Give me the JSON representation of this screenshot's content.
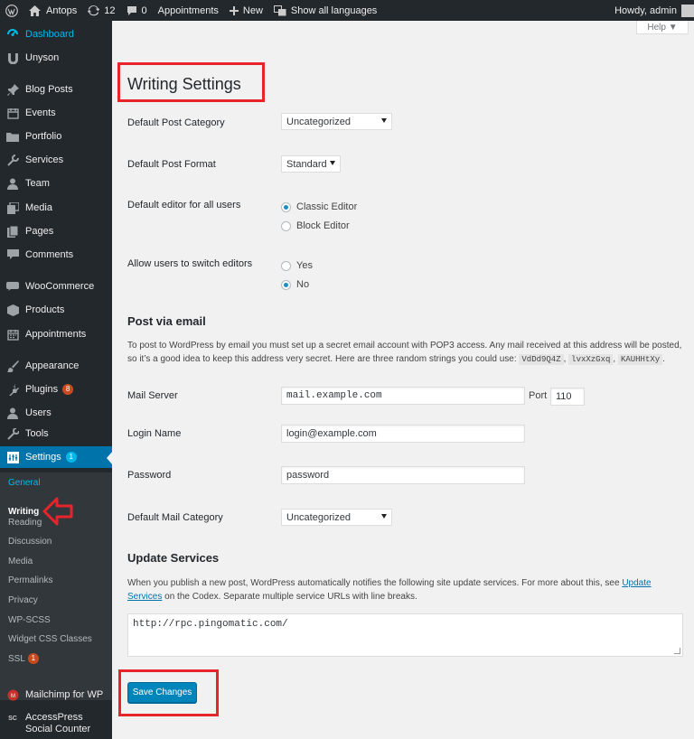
{
  "adminbar": {
    "site_name": "Antops",
    "updates_count": "12",
    "comments_count": "0",
    "appointments": "Appointments",
    "new": "New",
    "languages": "Show all languages",
    "howdy": "Howdy, admin"
  },
  "sidebar": {
    "items": [
      {
        "label": "Dashboard",
        "icon": "dashboard-icon"
      },
      {
        "label": "Unyson",
        "icon": "unyson-icon"
      },
      {
        "label": "Blog Posts",
        "icon": "pin-icon"
      },
      {
        "label": "Events",
        "icon": "calendar-icon"
      },
      {
        "label": "Portfolio",
        "icon": "folder-icon"
      },
      {
        "label": "Services",
        "icon": "wrench-icon"
      },
      {
        "label": "Team",
        "icon": "user-icon"
      },
      {
        "label": "Media",
        "icon": "media-icon"
      },
      {
        "label": "Pages",
        "icon": "pages-icon"
      },
      {
        "label": "Comments",
        "icon": "comment-icon"
      },
      {
        "label": "WooCommerce",
        "icon": "woocommerce-icon"
      },
      {
        "label": "Products",
        "icon": "products-icon"
      },
      {
        "label": "Appointments",
        "icon": "calendar-icon"
      },
      {
        "label": "Appearance",
        "icon": "brush-icon"
      },
      {
        "label": "Plugins",
        "icon": "plugin-icon",
        "badge": "8"
      },
      {
        "label": "Users",
        "icon": "users-icon"
      },
      {
        "label": "Tools",
        "icon": "tools-icon"
      },
      {
        "label": "Settings",
        "icon": "settings-icon",
        "badge": "1"
      },
      {
        "label": "Mailchimp for WP",
        "icon": "mailchimp-icon"
      },
      {
        "label": "AccessPress Social Counter",
        "icon": "sc-icon"
      }
    ],
    "submenu": [
      {
        "label": "General"
      },
      {
        "label": "Writing"
      },
      {
        "label": "Reading"
      },
      {
        "label": "Discussion"
      },
      {
        "label": "Media"
      },
      {
        "label": "Permalinks"
      },
      {
        "label": "Privacy"
      },
      {
        "label": "WP-SCSS"
      },
      {
        "label": "Widget CSS Classes"
      },
      {
        "label": "SSL",
        "badge": "1"
      }
    ]
  },
  "help": "Help ▼",
  "page_title": "Writing Settings",
  "fields": {
    "default_post_category": {
      "label": "Default Post Category",
      "value": "Uncategorized"
    },
    "default_post_format": {
      "label": "Default Post Format",
      "value": "Standard"
    },
    "default_editor": {
      "label": "Default editor for all users",
      "options": [
        "Classic Editor",
        "Block Editor"
      ],
      "selected": "Classic Editor"
    },
    "switch_editors": {
      "label": "Allow users to switch editors",
      "options": [
        "Yes",
        "No"
      ],
      "selected": "No"
    }
  },
  "post_via_email": {
    "title": "Post via email",
    "desc_part1": "To post to WordPress by email you must set up a secret email account with POP3 access. Any mail received at this address will be posted, so it’s a good idea to keep this address very secret. Here are three random strings you could use:",
    "codes": [
      "VdDd9Q4Z",
      "lvxXzGxq",
      "KAUHHtXy"
    ],
    "mail_server_label": "Mail Server",
    "mail_server_value": "mail.example.com",
    "port_label": "Port",
    "port_value": "110",
    "login_label": "Login Name",
    "login_value": "login@example.com",
    "password_label": "Password",
    "password_value": "password",
    "mail_category_label": "Default Mail Category",
    "mail_category_value": "Uncategorized"
  },
  "update_services": {
    "title": "Update Services",
    "desc_part1": "When you publish a new post, WordPress automatically notifies the following site update services. For more about this, see",
    "link": "Update Services",
    "desc_part2": "on the Codex. Separate multiple service URLs with line breaks.",
    "value": "http://rpc.pingomatic.com/"
  },
  "save_label": "Save Changes",
  "colors": {
    "accent": "#0073aa",
    "annotation": "#e8242b",
    "sidebar": "#23282d"
  }
}
